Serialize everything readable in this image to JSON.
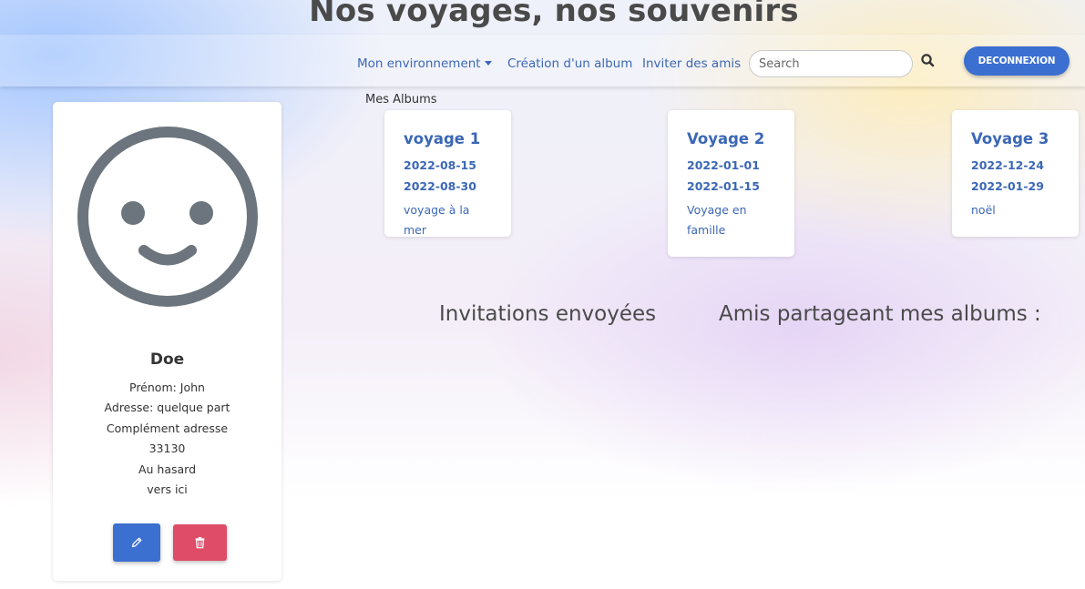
{
  "header": {
    "site_title": "Nos voyages, nos souvenirs"
  },
  "nav": {
    "environment_label": "Mon environnement",
    "create_album_label": "Création d'un album",
    "invite_friends_label": "Inviter des amis",
    "search_placeholder": "Search",
    "search_value": "",
    "logout_label": "DECONNEXION"
  },
  "profile": {
    "avatar_icon": "smiley-face-icon",
    "last_name": "Doe",
    "first_name": "Prénom: John",
    "address": "Adresse: quelque part",
    "address_complement": "Complément adresse",
    "postal_code": "33130",
    "city": "Au hasard",
    "country": "vers ici",
    "edit_icon": "pencil-icon",
    "delete_icon": "trash-icon"
  },
  "albums": {
    "heading": "Mes Albums",
    "items": [
      {
        "title": "voyage 1",
        "start_date": "2022-08-15",
        "end_date": "2022-08-30",
        "description": "voyage à la mer"
      },
      {
        "title": "Voyage 2",
        "start_date": "2022-01-01",
        "end_date": "2022-01-15",
        "description": "Voyage en famille"
      },
      {
        "title": "Voyage 3",
        "start_date": "2022-12-24",
        "end_date": "2022-01-29",
        "description": "noël"
      }
    ]
  },
  "sections": {
    "invitations_heading": "Invitations envoyées",
    "friends_heading": "Amis partageant mes albums :"
  },
  "colors": {
    "primary": "#3b6fd0",
    "danger": "#df4c67",
    "link": "#3b67b5",
    "avatar_gray": "#6c757d"
  }
}
